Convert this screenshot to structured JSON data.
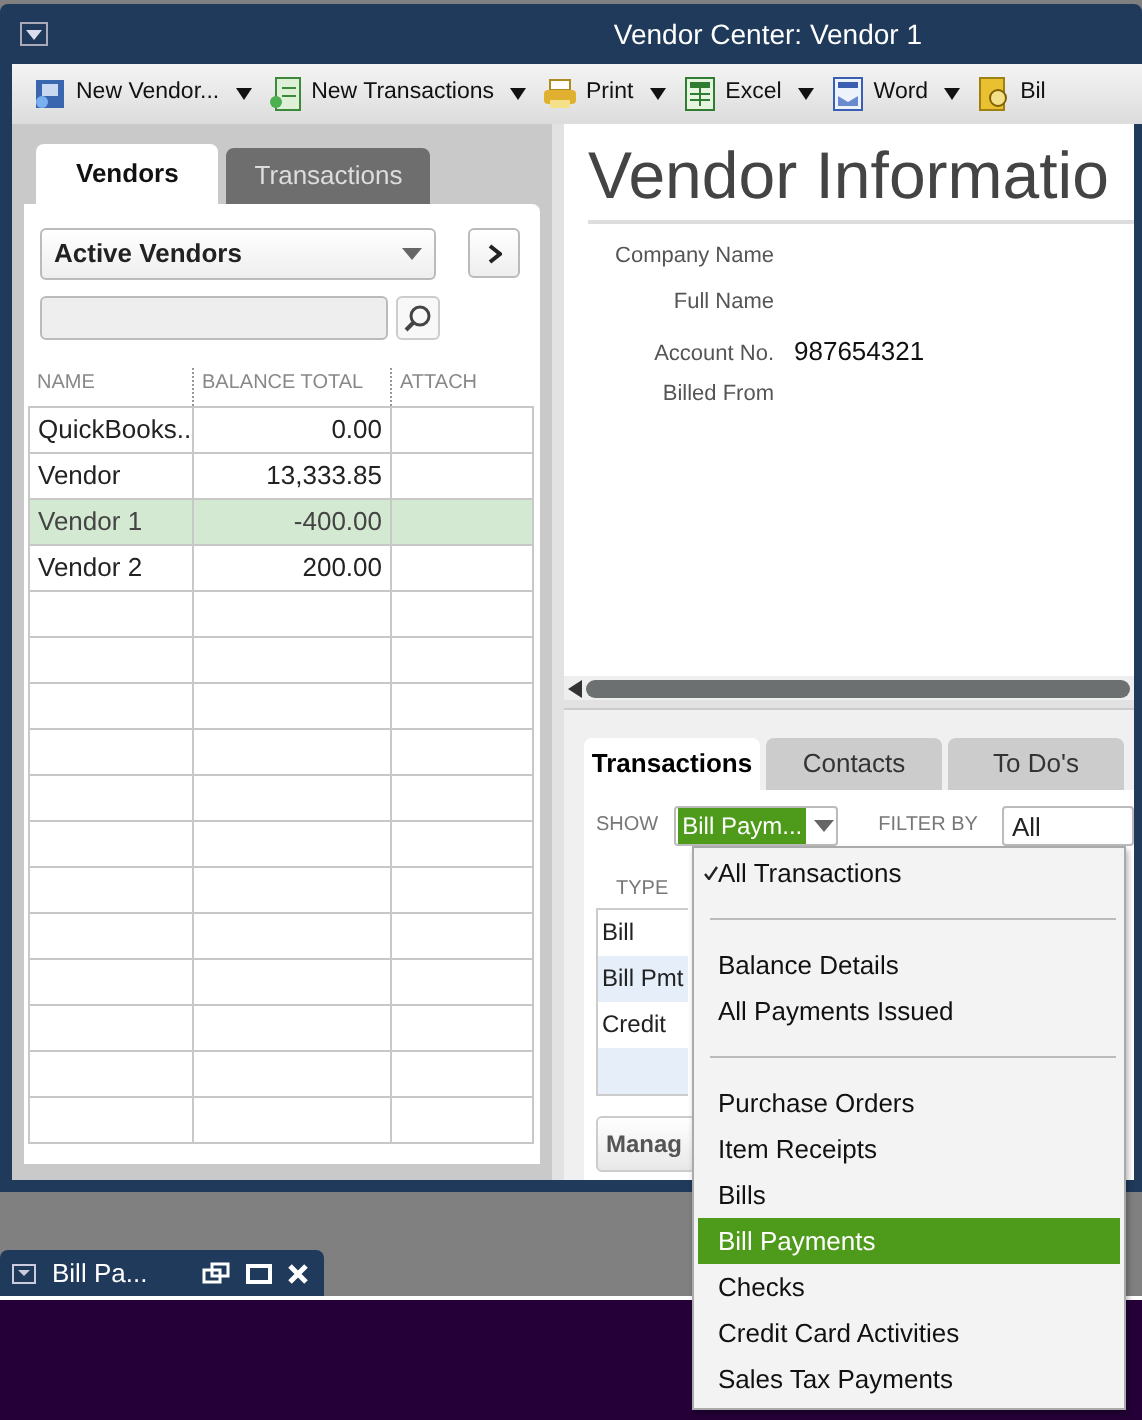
{
  "window": {
    "title": "Vendor Center: Vendor 1"
  },
  "toolbar": [
    {
      "label": "New Vendor...",
      "kind": "dropdown"
    },
    {
      "label": "New Transactions",
      "kind": "dropdown"
    },
    {
      "label": "Print",
      "kind": "dropdown"
    },
    {
      "label": "Excel",
      "kind": "dropdown"
    },
    {
      "label": "Word",
      "kind": "dropdown"
    },
    {
      "label": "Bil",
      "kind": "button"
    }
  ],
  "left_tabs": [
    {
      "label": "Vendors",
      "selected": true
    },
    {
      "label": "Transactions",
      "selected": false
    }
  ],
  "vendor_filter": {
    "value": "Active Vendors"
  },
  "vendor_table": {
    "columns": [
      "NAME",
      "BALANCE TOTAL",
      "ATTACH"
    ],
    "rows": [
      {
        "name": "QuickBooks...",
        "balance": "0.00",
        "selected": false
      },
      {
        "name": "Vendor",
        "balance": "13,333.85",
        "selected": false
      },
      {
        "name": "Vendor 1",
        "balance": "-400.00",
        "selected": true
      },
      {
        "name": "Vendor 2",
        "balance": "200.00",
        "selected": false
      }
    ]
  },
  "vendor_info": {
    "title": "Vendor Informatio",
    "fields": [
      {
        "label": "Company Name"
      },
      {
        "label": "Full Name"
      },
      {
        "label": "Account No.",
        "value": "987654321"
      },
      {
        "label": "Billed From"
      }
    ]
  },
  "bottom_tabs": [
    {
      "label": "Transactions",
      "selected": true
    },
    {
      "label": "Contacts",
      "selected": false
    },
    {
      "label": "To Do's",
      "selected": false
    }
  ],
  "show": {
    "label": "SHOW",
    "value": "Bill Paym..."
  },
  "filter": {
    "label": "FILTER BY",
    "value": "All"
  },
  "transactions": {
    "columns": [
      "TYPE"
    ],
    "rows": [
      "Bill",
      "Bill Pmt",
      "Credit"
    ]
  },
  "manage_button": "Manag",
  "show_menu": [
    {
      "kind": "item",
      "label": "All Transactions",
      "checked": true,
      "selected": false
    },
    {
      "kind": "separator"
    },
    {
      "kind": "item",
      "label": "Balance Details",
      "checked": false,
      "selected": false
    },
    {
      "kind": "item",
      "label": "All Payments Issued",
      "checked": false,
      "selected": false
    },
    {
      "kind": "separator"
    },
    {
      "kind": "item",
      "label": "Purchase Orders",
      "checked": false,
      "selected": false
    },
    {
      "kind": "item",
      "label": "Item Receipts",
      "checked": false,
      "selected": false
    },
    {
      "kind": "item",
      "label": "Bills",
      "checked": false,
      "selected": false
    },
    {
      "kind": "item",
      "label": "Bill Payments",
      "checked": false,
      "selected": true
    },
    {
      "kind": "item",
      "label": "Checks",
      "checked": false,
      "selected": false
    },
    {
      "kind": "item",
      "label": "Credit Card Activities",
      "checked": false,
      "selected": false
    },
    {
      "kind": "item",
      "label": "Sales Tax Payments",
      "checked": false,
      "selected": false
    }
  ],
  "minimized_window": {
    "title": "Bill Pa..."
  }
}
